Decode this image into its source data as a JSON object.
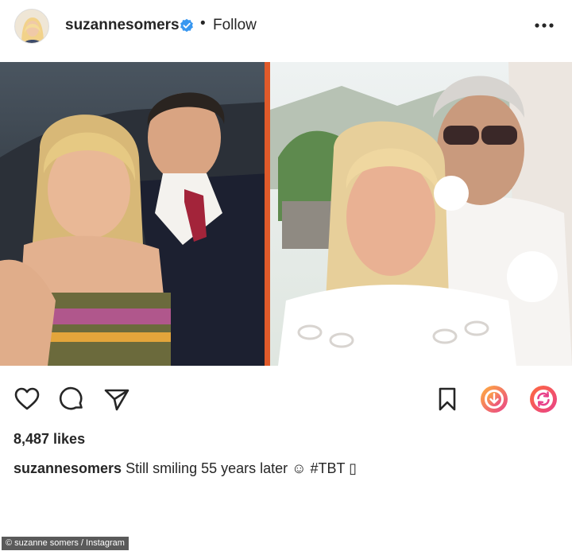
{
  "post": {
    "username": "suzannesomers",
    "dot": "•",
    "follow_label": "Follow",
    "more_icon": "more-horizontal-icon",
    "verified_icon": "verified-badge-icon"
  },
  "actions": {
    "like_icon": "heart-icon",
    "comment_icon": "comment-icon",
    "share_icon": "send-icon",
    "save_icon": "bookmark-icon",
    "accent_orange": "#ff6a3d",
    "accent_pink": "#e8418a"
  },
  "engagement": {
    "likes": "8,487 likes"
  },
  "caption": {
    "username": "suzannesomers",
    "text": " Still smiling 55 years later ☺ #TBT ▯"
  },
  "credit": {
    "text": "© suzanne somers / Instagram"
  },
  "colors": {
    "divider": "#e05a2a"
  }
}
